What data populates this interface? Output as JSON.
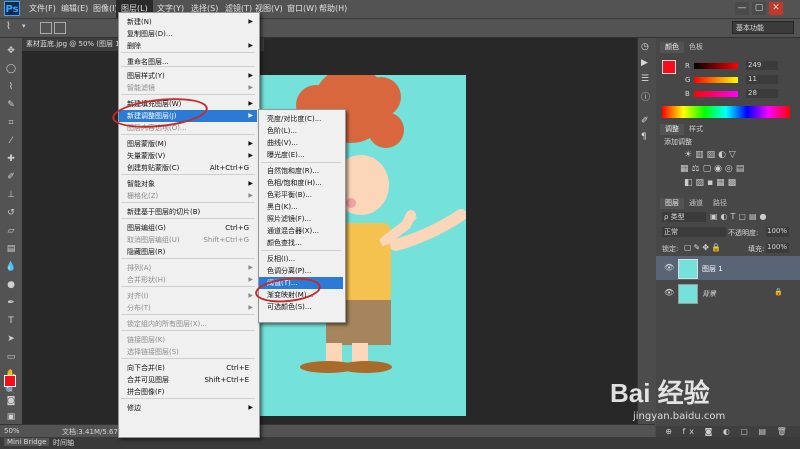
{
  "app": {
    "logo": "Ps"
  },
  "menubar": [
    "文件(F)",
    "编辑(E)",
    "图像(I)",
    "图层(L)",
    "文字(Y)",
    "选择(S)",
    "滤镜(T)",
    "视图(V)",
    "窗口(W)",
    "帮助(H)"
  ],
  "window_controls": [
    "—",
    "▢",
    "✕"
  ],
  "workspace": "基本功能",
  "document": {
    "tab_title": "素材蓝底.jpg @ 50% (图层 1, RGB/8)",
    "zoom": "50%",
    "doc_info": "文档:3.41M/5.67M"
  },
  "bottom_tabs": [
    "Mini Bridge",
    "时间轴"
  ],
  "layer_menu": {
    "items": [
      {
        "label": "新建(N)",
        "arrow": true
      },
      {
        "label": "复制图层(D)..."
      },
      {
        "label": "删除",
        "arrow": true
      },
      {
        "label": "重命名图层..."
      },
      {
        "label": "图层样式(Y)",
        "arrow": true
      },
      {
        "label": "智能滤镜",
        "arrow": true,
        "disabled": true
      },
      {
        "label": "新建填充图层(W)",
        "arrow": true
      },
      {
        "label": "新建调整图层(J)",
        "arrow": true,
        "highlight": true
      },
      {
        "label": "图层内容选项(O)...",
        "disabled": true
      },
      {
        "label": "图层蒙版(M)",
        "arrow": true
      },
      {
        "label": "矢量蒙版(V)",
        "arrow": true
      },
      {
        "label": "创建剪贴蒙版(C)",
        "shortcut": "Alt+Ctrl+G"
      },
      {
        "label": "智能对象",
        "arrow": true
      },
      {
        "label": "栅格化(Z)",
        "arrow": true,
        "disabled": true
      },
      {
        "label": "新建基于图层的切片(B)"
      },
      {
        "label": "图层编组(G)",
        "shortcut": "Ctrl+G"
      },
      {
        "label": "取消图层编组(U)",
        "shortcut": "Shift+Ctrl+G",
        "disabled": true
      },
      {
        "label": "隐藏图层(R)"
      },
      {
        "label": "排列(A)",
        "arrow": true,
        "disabled": true
      },
      {
        "label": "合并形状(H)",
        "arrow": true,
        "disabled": true
      },
      {
        "label": "对齐(I)",
        "arrow": true,
        "disabled": true
      },
      {
        "label": "分布(T)",
        "arrow": true,
        "disabled": true
      },
      {
        "label": "锁定组内的所有图层(X)...",
        "disabled": true
      },
      {
        "label": "链接图层(K)",
        "disabled": true
      },
      {
        "label": "选择链接图层(S)",
        "disabled": true
      },
      {
        "label": "向下合并(E)",
        "shortcut": "Ctrl+E"
      },
      {
        "label": "合并可见图层",
        "shortcut": "Shift+Ctrl+E"
      },
      {
        "label": "拼合图像(F)"
      },
      {
        "label": "修边",
        "arrow": true
      }
    ]
  },
  "adjust_menu": {
    "items": [
      {
        "label": "亮度/对比度(C)..."
      },
      {
        "label": "色阶(L)..."
      },
      {
        "label": "曲线(V)..."
      },
      {
        "label": "曝光度(E)..."
      },
      {
        "label": "自然饱和度(R)..."
      },
      {
        "label": "色相/饱和度(H)..."
      },
      {
        "label": "色彩平衡(B)..."
      },
      {
        "label": "黑白(K)..."
      },
      {
        "label": "照片滤镜(F)..."
      },
      {
        "label": "通道混合器(X)..."
      },
      {
        "label": "颜色查找..."
      },
      {
        "label": "反相(I)..."
      },
      {
        "label": "色调分离(P)..."
      },
      {
        "label": "阈值(T)...",
        "highlight": true
      },
      {
        "label": "渐变映射(M)..."
      },
      {
        "label": "可选颜色(S)..."
      }
    ]
  },
  "color_panel": {
    "tabs": [
      "颜色",
      "色板"
    ],
    "r_label": "R",
    "g_label": "G",
    "b_label": "B",
    "r": "249",
    "g": "11",
    "b": "28",
    "fg_color": "#f90b1c"
  },
  "adjustments_panel": {
    "tabs": [
      "调整",
      "样式"
    ],
    "title": "添加调整"
  },
  "layers_panel": {
    "tabs": [
      "图层",
      "通道",
      "路径"
    ],
    "kind_filter": "ρ 类型",
    "blend_mode": "正常",
    "opacity_label": "不透明度:",
    "opacity": "100%",
    "lock_label": "锁定:",
    "fill_label": "填充:",
    "fill": "100%",
    "layers": [
      {
        "name": "图层 1",
        "selected": true
      },
      {
        "name": "背景",
        "locked": true
      }
    ],
    "footer_icons": "⊕ fx ◙ ◐ ▢ ▤ 🗑"
  },
  "watermark": {
    "brand": "Bai 经验",
    "url": "jingyan.baidu.com"
  }
}
